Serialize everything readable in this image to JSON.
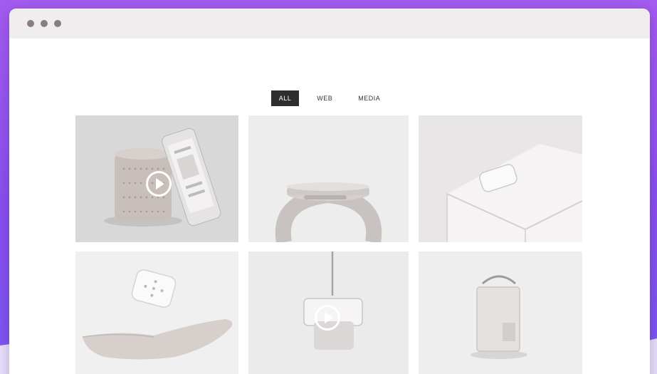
{
  "window": {
    "controls": [
      "window-dot",
      "window-dot",
      "window-dot"
    ]
  },
  "filters": [
    {
      "label": "ALL",
      "active": true
    },
    {
      "label": "WEB",
      "active": false
    },
    {
      "label": "MEDIA",
      "active": false
    }
  ],
  "gallery": {
    "items": [
      {
        "subject": "speaker-and-phone",
        "has_video": true
      },
      {
        "subject": "watch",
        "has_video": false
      },
      {
        "subject": "device-corner",
        "has_video": false
      },
      {
        "subject": "remote-over-hand",
        "has_video": false
      },
      {
        "subject": "wall-device",
        "has_video": true
      },
      {
        "subject": "pouch",
        "has_video": false
      }
    ]
  },
  "colors": {
    "background_gradient_top": "#a45cf0",
    "background_gradient_bottom": "#7b56f2",
    "titlebar": "#efeded",
    "active_filter": "#2e2e2e",
    "tile_background": "#e9e8e8"
  }
}
